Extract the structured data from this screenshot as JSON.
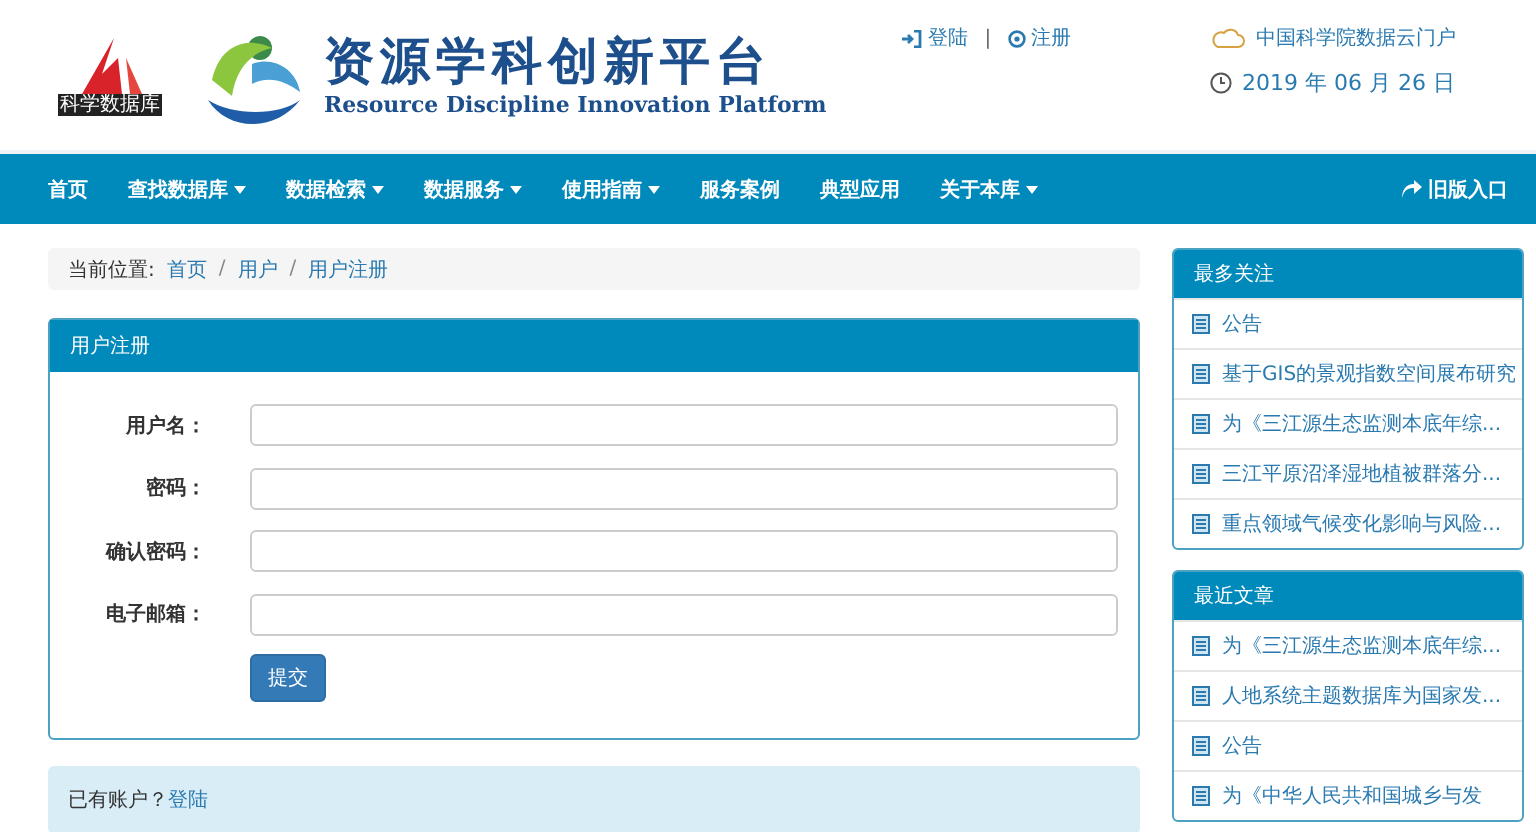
{
  "header": {
    "logo_label": "科学数据库",
    "title": "资源学科创新平台",
    "subtitle": "Resource Discipline Innovation Platform",
    "links": [
      {
        "kind": "login",
        "label": "登陆"
      },
      {
        "kind": "register",
        "label": "注册"
      }
    ],
    "separator": "|",
    "portal": "中国科学院数据云门户",
    "date": "2019 年 06 月 26 日"
  },
  "nav": {
    "items": [
      {
        "label": "首页",
        "dropdown": false
      },
      {
        "label": "查找数据库",
        "dropdown": true
      },
      {
        "label": "数据检索",
        "dropdown": true
      },
      {
        "label": "数据服务",
        "dropdown": true
      },
      {
        "label": "使用指南",
        "dropdown": true
      },
      {
        "label": "服务案例",
        "dropdown": false
      },
      {
        "label": "典型应用",
        "dropdown": false
      },
      {
        "label": "关于本库",
        "dropdown": true
      }
    ],
    "old_version": "旧版入口"
  },
  "breadcrumb": {
    "prefix": "当前位置:",
    "separator": "/",
    "items": [
      "首页",
      "用户",
      "用户注册"
    ]
  },
  "form": {
    "title": "用户注册",
    "fields": [
      {
        "label": "用户名："
      },
      {
        "label": "密码："
      },
      {
        "label": "确认密码："
      },
      {
        "label": "电子邮箱："
      }
    ],
    "submit": "提交"
  },
  "login_hint": {
    "text": "已有账户？",
    "link": "登陆"
  },
  "sidebar": [
    {
      "title": "最多关注",
      "items": [
        "公告",
        "基于GIS的景观指数空间展布研究",
        "为《三江源生态监测本底年综...",
        "三江平原沼泽湿地植被群落分...",
        "重点领域气候变化影响与风险..."
      ]
    },
    {
      "title": "最近文章",
      "items": [
        "为《三江源生态监测本底年综...",
        "人地系统主题数据库为国家发...",
        "公告",
        "为《中华人民共和国城乡与发"
      ]
    }
  ]
}
